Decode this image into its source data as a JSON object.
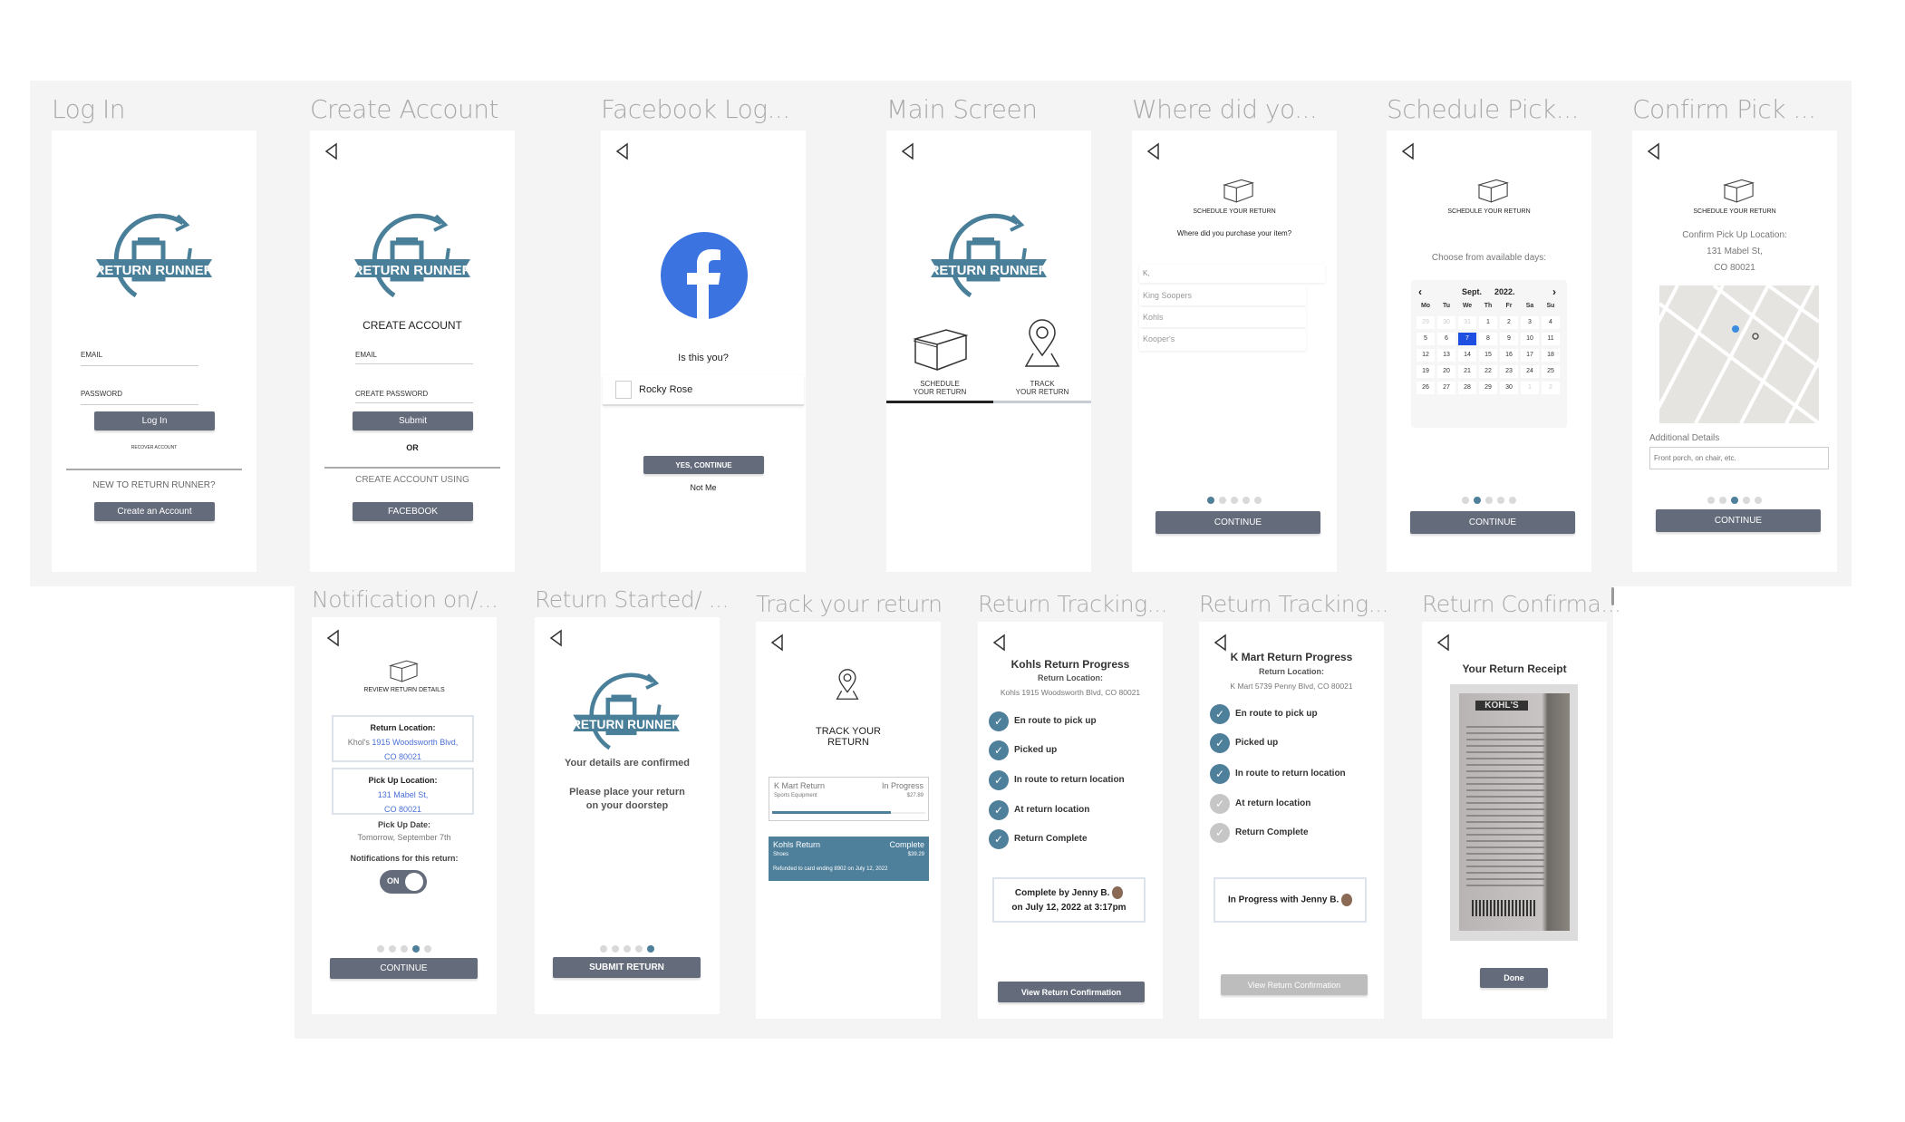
{
  "logo_text": "RETURN RUNNER",
  "colors": {
    "accent": "#4e7f9b",
    "button": "#646b7b",
    "facebook": "#3b74e0",
    "selected_day": "#1f4fe0",
    "disabled": "#bdbdbd"
  },
  "icons": {
    "back": "back-arrow-icon",
    "box": "box-icon",
    "pin": "location-pin-icon",
    "check": "check-icon"
  },
  "login": {
    "title": "Log In",
    "email": "EMAIL",
    "password": "PASSWORD",
    "login_btn": "Log In",
    "recover": "RECOVER ACCOUNT",
    "new_to": "NEW TO RETURN RUNNER?",
    "create_btn": "Create an Account"
  },
  "create": {
    "title": "Create Account",
    "heading": "CREATE ACCOUNT",
    "email": "EMAIL",
    "password": "CREATE PASSWORD",
    "submit": "Submit",
    "or": "OR",
    "using": "CREATE ACCOUNT USING",
    "facebook": "FACEBOOK"
  },
  "fb": {
    "title": "Facebook Log...",
    "question": "Is this you?",
    "name": "Rocky Rose",
    "yes": "YES, CONTINUE",
    "not_me": "Not Me"
  },
  "main": {
    "title": "Main Screen",
    "schedule": "SCHEDULE",
    "schedule2": "YOUR RETURN",
    "track": "TRACK",
    "track2": "YOUR RETURN"
  },
  "where": {
    "title": "Where did yo...",
    "heading": "SCHEDULE YOUR RETURN",
    "question": "Where did you purchase your item?",
    "input": "K,",
    "options": [
      "King Soopers",
      "Kohls",
      "Kooper's"
    ],
    "continue": "CONTINUE"
  },
  "schedule": {
    "title": "Schedule Pick...",
    "heading": "SCHEDULE YOUR RETURN",
    "prompt": "Choose from available days:",
    "month": "Sept.",
    "year": "2022.",
    "prev": "‹",
    "next": "›",
    "weekdays": [
      "Mo",
      "Tu",
      "We",
      "Th",
      "Fr",
      "Sa",
      "Su"
    ],
    "days": [
      [
        "29",
        1
      ],
      [
        "30",
        1
      ],
      [
        "31",
        1
      ],
      [
        "1",
        0
      ],
      [
        "2",
        0
      ],
      [
        "3",
        0
      ],
      [
        "4",
        0
      ],
      [
        "5",
        0
      ],
      [
        "6",
        0
      ],
      [
        "7",
        2
      ],
      [
        "8",
        0
      ],
      [
        "9",
        0
      ],
      [
        "10",
        0
      ],
      [
        "11",
        0
      ],
      [
        "12",
        0
      ],
      [
        "13",
        0
      ],
      [
        "14",
        0
      ],
      [
        "15",
        0
      ],
      [
        "16",
        0
      ],
      [
        "17",
        0
      ],
      [
        "18",
        0
      ],
      [
        "19",
        0
      ],
      [
        "20",
        0
      ],
      [
        "21",
        0
      ],
      [
        "22",
        0
      ],
      [
        "23",
        0
      ],
      [
        "24",
        0
      ],
      [
        "25",
        0
      ],
      [
        "26",
        0
      ],
      [
        "27",
        0
      ],
      [
        "28",
        0
      ],
      [
        "29",
        0
      ],
      [
        "30",
        0
      ],
      [
        "1",
        1
      ],
      [
        "2",
        1
      ]
    ],
    "continue": "CONTINUE"
  },
  "confirm": {
    "title": "Confirm Pick ...",
    "heading": "SCHEDULE YOUR RETURN",
    "line1": "Confirm Pick Up Location:",
    "line2": "131 Mabel St,",
    "line3": "CO 80021",
    "details_label": "Additional Details",
    "details_placeholder": "Front porch, on chair, etc.",
    "continue": "CONTINUE"
  },
  "notif": {
    "title": "Notification on/...",
    "heading": "REVIEW RETURN DETAILS",
    "rl_label": "Return Location:",
    "rl_store": "Khol's ",
    "rl_addr": "1915 Woodsworth Blvd,",
    "rl_zip": "CO 80021",
    "pl_label": "Pick Up Location:",
    "pl_addr": "131 Mabel St,",
    "pl_zip": "CO 80021",
    "date_label": "Pick Up Date:",
    "date": "Tomorrow, September 7th",
    "notif_label": "Notifications for this return:",
    "toggle": "ON",
    "continue": "CONTINUE"
  },
  "started": {
    "title": "Return Started/ ...",
    "confirmed": "Your details are confirmed",
    "place1": "Please place your return",
    "place2": "on your doorstep",
    "submit": "SUBMIT RETURN"
  },
  "track": {
    "title": "Track your return",
    "heading1": "TRACK YOUR",
    "heading2": "RETURN",
    "kmart": {
      "name": "K Mart Return",
      "status": "In Progress",
      "category": "Sports Equipment",
      "price": "$27.89",
      "progress": 0.75
    },
    "kohls": {
      "name": "Kohls Return",
      "status": "Complete",
      "category": "Shoes",
      "price": "$39.29",
      "note": "Refunded to card ending 8902 on July 12, 2022"
    }
  },
  "tracking1": {
    "title": "Return Tracking...",
    "heading": "Kohls Return Progress",
    "rl": "Return Location:",
    "addr": "Kohls 1915 Woodsworth Blvd, CO 80021",
    "steps": [
      "En route to pick up",
      "Picked up",
      "In route to return location",
      "At return location",
      "Return Complete"
    ],
    "done_count": 5,
    "status1": "Complete by Jenny B.",
    "status2": "on July 12, 2022 at 3:17pm",
    "button": "View Return Confirmation"
  },
  "tracking2": {
    "title": "Return Tracking...",
    "heading": "K Mart Return Progress",
    "rl": "Return Location:",
    "addr": "K Mart 5739 Penny Blvd, CO 80021",
    "steps": [
      "En route to pick up",
      "Picked up",
      "In route to return location",
      "At return location",
      "Return Complete"
    ],
    "done_count": 3,
    "status1": "In Progress with Jenny B.",
    "button": "View Return Confirmation"
  },
  "receipt": {
    "title": "Return Confirma...",
    "heading": "Your Return Receipt",
    "store": "KOHL'S",
    "done": "Done"
  }
}
